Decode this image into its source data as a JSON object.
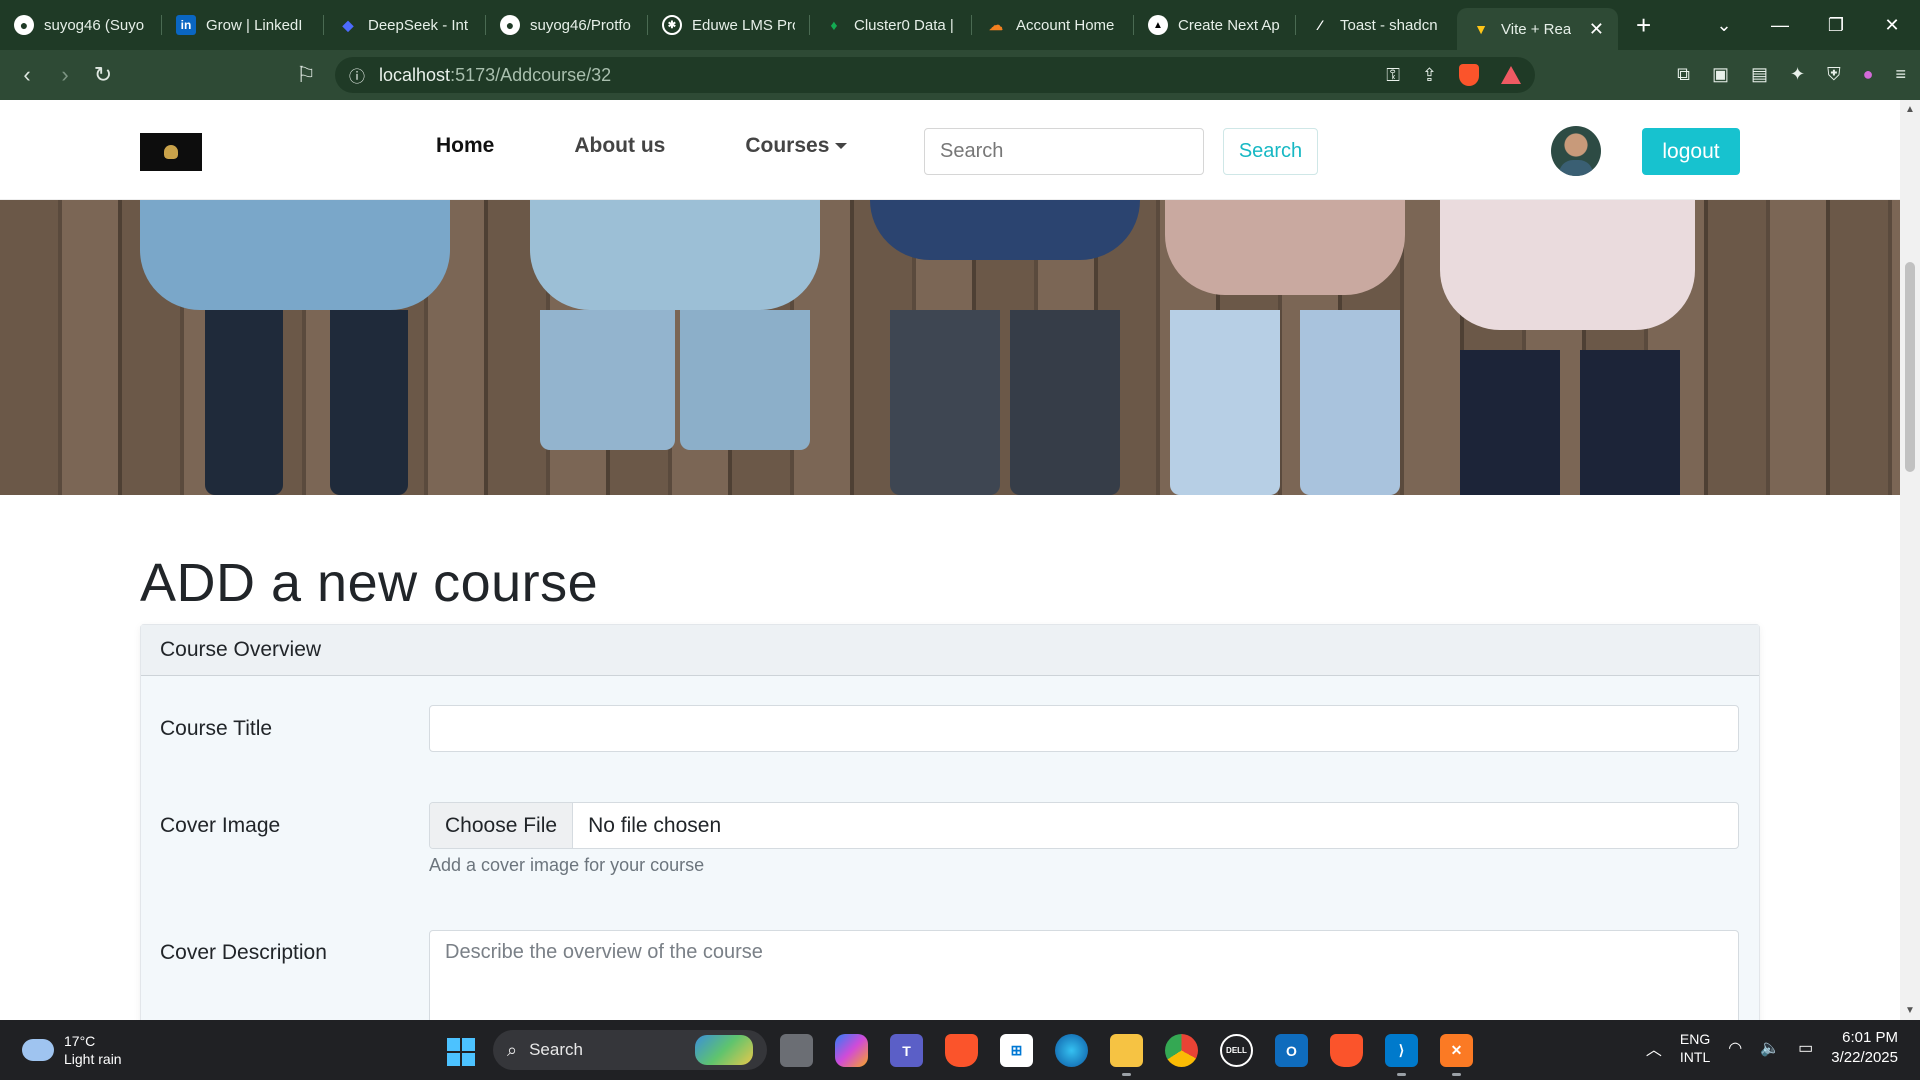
{
  "browser": {
    "tabs": [
      {
        "title": "suyog46 (Suyo",
        "icon": "github-icon",
        "icon_color": "#ffffff"
      },
      {
        "title": "Grow | LinkedI",
        "icon": "linkedin-icon",
        "icon_color": "#0a66c2"
      },
      {
        "title": "DeepSeek - Int",
        "icon": "deepseek-icon",
        "icon_color": "#4d6bfe"
      },
      {
        "title": "suyog46/Protfo",
        "icon": "github-icon",
        "icon_color": "#ffffff"
      },
      {
        "title": "Eduwe LMS Pro",
        "icon": "openai-icon",
        "icon_color": "#ffffff"
      },
      {
        "title": "Cluster0 Data |",
        "icon": "mongodb-leaf-icon",
        "icon_color": "#13aa52"
      },
      {
        "title": "Account Home",
        "icon": "cloudflare-icon",
        "icon_color": "#f38020"
      },
      {
        "title": "Create Next Ap",
        "icon": "vercel-icon",
        "icon_color": "#ffffff"
      },
      {
        "title": "Toast - shadcn",
        "icon": "shadcn-icon",
        "icon_color": "#ffffff"
      },
      {
        "title": "Vite + Rea",
        "icon": "vite-icon",
        "icon_color": "#bd34fe",
        "active": true
      }
    ],
    "new_tab": "+",
    "url": "localhost:5173/Addcourse/32",
    "url_host": "localhost",
    "url_rest": ":5173/Addcourse/32"
  },
  "site": {
    "nav": {
      "links": [
        "Home",
        "About us",
        "Courses"
      ],
      "search_placeholder": "Search",
      "search_button": "Search",
      "logout_button": "logout"
    },
    "page_title": "ADD a new course",
    "card": {
      "header": "Course Overview",
      "fields": {
        "title_label": "Course Title",
        "title_value": "",
        "cover_image_label": "Cover Image",
        "file_button": "Choose File",
        "file_status": "No file chosen",
        "cover_image_help": "Add a cover image for your course",
        "description_label": "Cover Description",
        "description_placeholder": "Describe the overview of the course"
      }
    },
    "accent_color": "#17c2cf"
  },
  "taskbar": {
    "weather_temp": "17°C",
    "weather_desc": "Light rain",
    "search_label": "Search",
    "apps": [
      "file-explorer-icon",
      "copilot-icon",
      "teams-icon",
      "brave-icon",
      "store-icon",
      "edge-icon",
      "folder-icon",
      "chrome-icon",
      "dell-icon",
      "outlook-icon",
      "brave-icon",
      "vscode-icon",
      "xampp-icon"
    ],
    "lang_top": "ENG",
    "lang_bottom": "INTL",
    "time": "6:01 PM",
    "date": "3/22/2025"
  }
}
